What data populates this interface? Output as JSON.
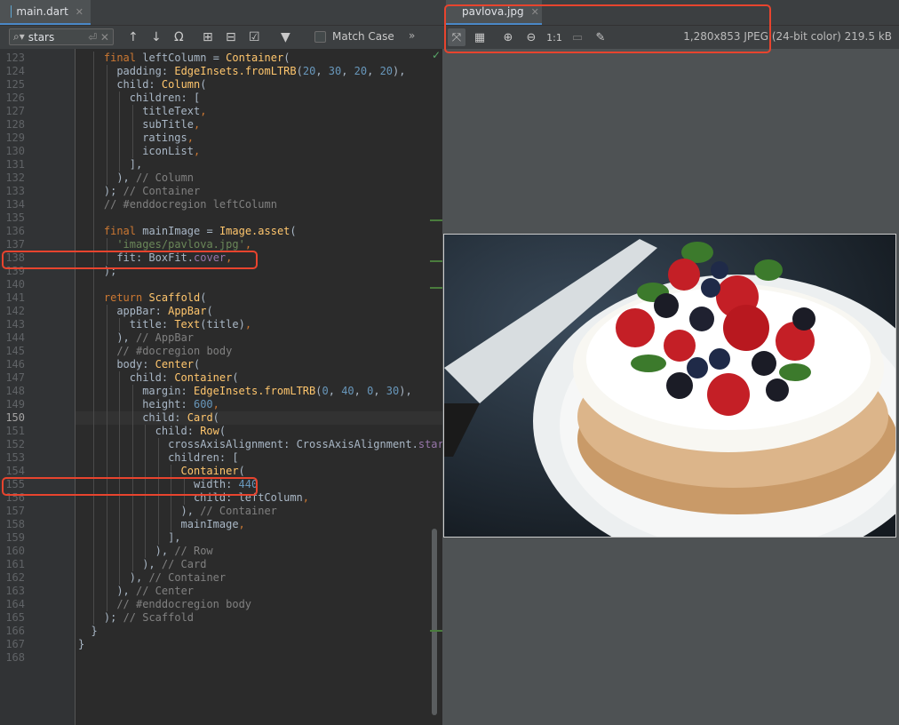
{
  "editor": {
    "tab_label": "main.dart",
    "search_value": "stars",
    "match_case_label": "Match Case",
    "lines": [
      {
        "n": "123",
        "t": [
          [
            "final ",
            "k"
          ],
          [
            "leftColumn = ",
            ""
          ],
          [
            "Container",
            "f"
          ],
          [
            "(",
            ""
          ]
        ],
        "indent": 2
      },
      {
        "n": "124",
        "t": [
          [
            "padding: ",
            ""
          ],
          [
            "EdgeInsets.fromLTRB",
            "f"
          ],
          [
            "(",
            ""
          ],
          [
            "20",
            "n"
          ],
          [
            ", ",
            ""
          ],
          [
            "30",
            "n"
          ],
          [
            ", ",
            ""
          ],
          [
            "20",
            "n"
          ],
          [
            ", ",
            ""
          ],
          [
            "20",
            "n"
          ],
          [
            "),",
            ""
          ]
        ],
        "indent": 3
      },
      {
        "n": "125",
        "t": [
          [
            "child: ",
            ""
          ],
          [
            "Column",
            "f"
          ],
          [
            "(",
            ""
          ]
        ],
        "indent": 3
      },
      {
        "n": "126",
        "t": [
          [
            "children: [",
            ""
          ]
        ],
        "indent": 4
      },
      {
        "n": "127",
        "t": [
          [
            "titleText",
            ""
          ],
          [
            ",",
            "k"
          ]
        ],
        "indent": 5
      },
      {
        "n": "128",
        "t": [
          [
            "subTitle",
            ""
          ],
          [
            ",",
            "k"
          ]
        ],
        "indent": 5
      },
      {
        "n": "129",
        "t": [
          [
            "ratings",
            ""
          ],
          [
            ",",
            "k"
          ]
        ],
        "indent": 5
      },
      {
        "n": "130",
        "t": [
          [
            "iconList",
            ""
          ],
          [
            ",",
            "k"
          ]
        ],
        "indent": 5
      },
      {
        "n": "131",
        "t": [
          [
            "],",
            ""
          ]
        ],
        "indent": 4
      },
      {
        "n": "132",
        "t": [
          [
            "), ",
            ""
          ],
          [
            "// Column",
            "c"
          ]
        ],
        "indent": 3
      },
      {
        "n": "133",
        "t": [
          [
            "); ",
            ""
          ],
          [
            "// Container",
            "c"
          ]
        ],
        "indent": 2
      },
      {
        "n": "134",
        "t": [
          [
            "// #enddocregion leftColumn",
            "c"
          ]
        ],
        "indent": 2
      },
      {
        "n": "135",
        "t": [],
        "indent": 2
      },
      {
        "n": "136",
        "t": [
          [
            "final ",
            "k"
          ],
          [
            "mainImage = ",
            ""
          ],
          [
            "Image.asset",
            "f"
          ],
          [
            "(",
            ""
          ]
        ],
        "indent": 2
      },
      {
        "n": "137",
        "t": [
          [
            "'images/pavlova.jpg'",
            "s"
          ],
          [
            ",",
            "k"
          ]
        ],
        "indent": 3
      },
      {
        "n": "138",
        "t": [
          [
            "fit: BoxFit.",
            ""
          ],
          [
            "cover",
            "p"
          ],
          [
            ",",
            "k"
          ]
        ],
        "indent": 3
      },
      {
        "n": "139",
        "t": [
          [
            ");",
            ""
          ]
        ],
        "indent": 2
      },
      {
        "n": "140",
        "t": [],
        "indent": 2
      },
      {
        "n": "141",
        "t": [
          [
            "return ",
            "k"
          ],
          [
            "Scaffold",
            "f"
          ],
          [
            "(",
            ""
          ]
        ],
        "indent": 2
      },
      {
        "n": "142",
        "t": [
          [
            "appBar: ",
            ""
          ],
          [
            "AppBar",
            "f"
          ],
          [
            "(",
            ""
          ]
        ],
        "indent": 3
      },
      {
        "n": "143",
        "t": [
          [
            "title: ",
            ""
          ],
          [
            "Text",
            "f"
          ],
          [
            "(title)",
            ""
          ],
          [
            ",",
            "k"
          ]
        ],
        "indent": 4
      },
      {
        "n": "144",
        "t": [
          [
            "), ",
            ""
          ],
          [
            "// AppBar",
            "c"
          ]
        ],
        "indent": 3
      },
      {
        "n": "145",
        "t": [
          [
            "// #docregion body",
            "c"
          ]
        ],
        "indent": 3
      },
      {
        "n": "146",
        "t": [
          [
            "body: ",
            ""
          ],
          [
            "Center",
            "f"
          ],
          [
            "(",
            ""
          ]
        ],
        "indent": 3
      },
      {
        "n": "147",
        "t": [
          [
            "child: ",
            ""
          ],
          [
            "Container",
            "f"
          ],
          [
            "(",
            ""
          ]
        ],
        "indent": 4
      },
      {
        "n": "148",
        "t": [
          [
            "margin: ",
            ""
          ],
          [
            "EdgeInsets.fromLTRB",
            "f"
          ],
          [
            "(",
            ""
          ],
          [
            "0",
            "n"
          ],
          [
            ", ",
            ""
          ],
          [
            "40",
            "n"
          ],
          [
            ", ",
            ""
          ],
          [
            "0",
            "n"
          ],
          [
            ", ",
            ""
          ],
          [
            "30",
            "n"
          ],
          [
            "),",
            ""
          ]
        ],
        "indent": 5
      },
      {
        "n": "149",
        "t": [
          [
            "height: ",
            ""
          ],
          [
            "600",
            "n"
          ],
          [
            ",",
            "k"
          ]
        ],
        "indent": 5
      },
      {
        "n": "150",
        "t": [
          [
            "child: ",
            ""
          ],
          [
            "Card",
            "f"
          ],
          [
            "(",
            ""
          ]
        ],
        "indent": 5
      },
      {
        "n": "151",
        "t": [
          [
            "child: ",
            ""
          ],
          [
            "Row",
            "f"
          ],
          [
            "(",
            ""
          ]
        ],
        "indent": 6
      },
      {
        "n": "152",
        "t": [
          [
            "crossAxisAlignment: CrossAxisAlignment.",
            ""
          ],
          [
            "start",
            "p"
          ],
          [
            ",",
            "k"
          ]
        ],
        "indent": 7
      },
      {
        "n": "153",
        "t": [
          [
            "children: [",
            ""
          ]
        ],
        "indent": 7
      },
      {
        "n": "154",
        "t": [
          [
            "Container",
            "f"
          ],
          [
            "(",
            ""
          ]
        ],
        "indent": 8
      },
      {
        "n": "155",
        "t": [
          [
            "width: ",
            ""
          ],
          [
            "440",
            "n"
          ]
        ],
        "indent": 9
      },
      {
        "n": "156",
        "t": [
          [
            "child: leftColumn",
            ""
          ],
          [
            ",",
            "k"
          ]
        ],
        "indent": 9
      },
      {
        "n": "157",
        "t": [
          [
            "), ",
            ""
          ],
          [
            "// Container",
            "c"
          ]
        ],
        "indent": 8
      },
      {
        "n": "158",
        "t": [
          [
            "mainImage",
            ""
          ],
          [
            ",",
            "k"
          ]
        ],
        "indent": 8
      },
      {
        "n": "159",
        "t": [
          [
            "],",
            ""
          ]
        ],
        "indent": 7
      },
      {
        "n": "160",
        "t": [
          [
            "), ",
            ""
          ],
          [
            "// Row",
            "c"
          ]
        ],
        "indent": 6
      },
      {
        "n": "161",
        "t": [
          [
            "), ",
            ""
          ],
          [
            "// Card",
            "c"
          ]
        ],
        "indent": 5
      },
      {
        "n": "162",
        "t": [
          [
            "), ",
            ""
          ],
          [
            "// Container",
            "c"
          ]
        ],
        "indent": 4
      },
      {
        "n": "163",
        "t": [
          [
            "), ",
            ""
          ],
          [
            "// Center",
            "c"
          ]
        ],
        "indent": 3
      },
      {
        "n": "164",
        "t": [
          [
            "// #enddocregion body",
            "c"
          ]
        ],
        "indent": 3
      },
      {
        "n": "165",
        "t": [
          [
            "); ",
            ""
          ],
          [
            "// Scaffold",
            "c"
          ]
        ],
        "indent": 2
      },
      {
        "n": "166",
        "t": [
          [
            "}",
            ""
          ]
        ],
        "indent": 1
      },
      {
        "n": "167",
        "t": [
          [
            "}",
            ""
          ]
        ],
        "indent": 0
      },
      {
        "n": "168",
        "t": [],
        "indent": 0
      }
    ],
    "current_line": "150"
  },
  "viewer": {
    "tab_label": "pavlova.jpg",
    "image_info": "1,280x853 JPEG (24-bit color) 219.5 kB",
    "zoom_1_1": "1:1"
  },
  "colors": {
    "highlight": "#e8442e",
    "keyword": "#cc7832",
    "string": "#6a8759",
    "number": "#6897bb",
    "comment": "#808080",
    "function": "#ffc66d"
  }
}
